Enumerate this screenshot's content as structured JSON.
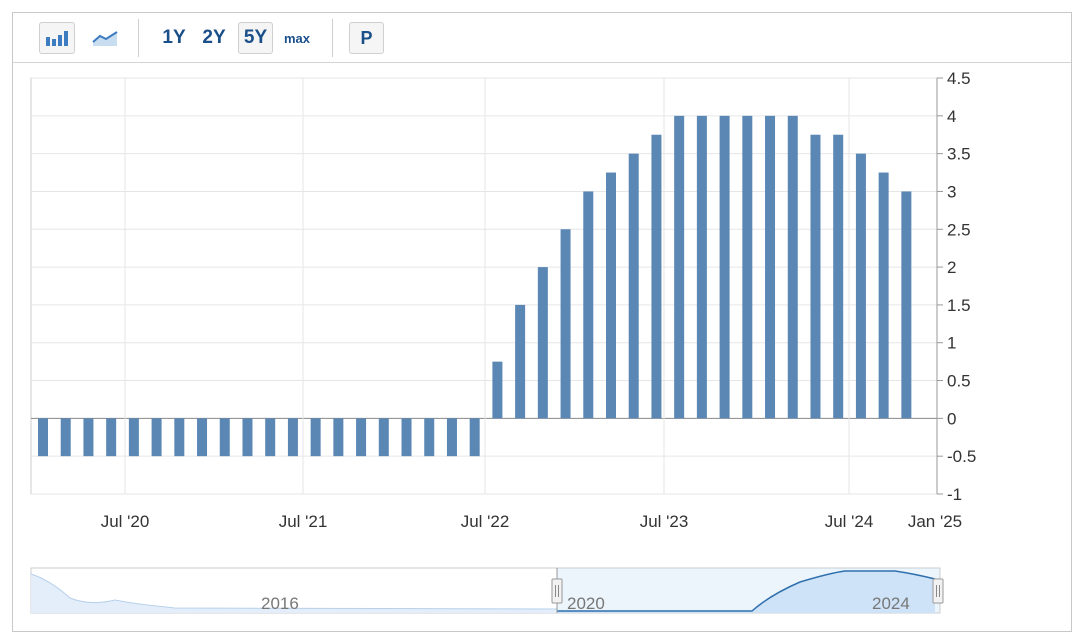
{
  "toolbar": {
    "bar_chart_icon": "bar-chart-icon",
    "line_chart_icon": "line-chart-icon",
    "range_1y": "1Y",
    "range_2y": "2Y",
    "range_5y": "5Y",
    "range_max": "max",
    "selected_range": "5Y",
    "p_button": "P"
  },
  "colors": {
    "bar": "#5b87b5",
    "navigator_fill": "#cfe3f8",
    "navigator_line": "#2e6fae"
  },
  "chart_data": {
    "type": "bar",
    "x_tick_labels": [
      "Jul '20",
      "Jul '21",
      "Jul '22",
      "Jul '23",
      "Jul '24",
      "Jan '25"
    ],
    "y_tick_labels": [
      "4.5",
      "4",
      "3.5",
      "3",
      "2.5",
      "2",
      "1.5",
      "1",
      "0.5",
      "0",
      "-0.5",
      "-1"
    ],
    "ylim": [
      -1,
      4.5
    ],
    "y_axis_side": "right",
    "grid": true,
    "values": [
      -0.5,
      -0.5,
      -0.5,
      -0.5,
      -0.5,
      -0.5,
      -0.5,
      -0.5,
      -0.5,
      -0.5,
      -0.5,
      -0.5,
      -0.5,
      -0.5,
      -0.5,
      -0.5,
      -0.5,
      -0.5,
      -0.5,
      -0.5,
      0.75,
      1.5,
      2,
      2.5,
      3,
      3.25,
      3.5,
      3.75,
      4,
      4,
      4,
      4,
      4,
      4,
      3.75,
      3.75,
      3.5,
      3.25,
      3
    ]
  },
  "navigator": {
    "labels": [
      "2016",
      "2020",
      "2024"
    ]
  }
}
